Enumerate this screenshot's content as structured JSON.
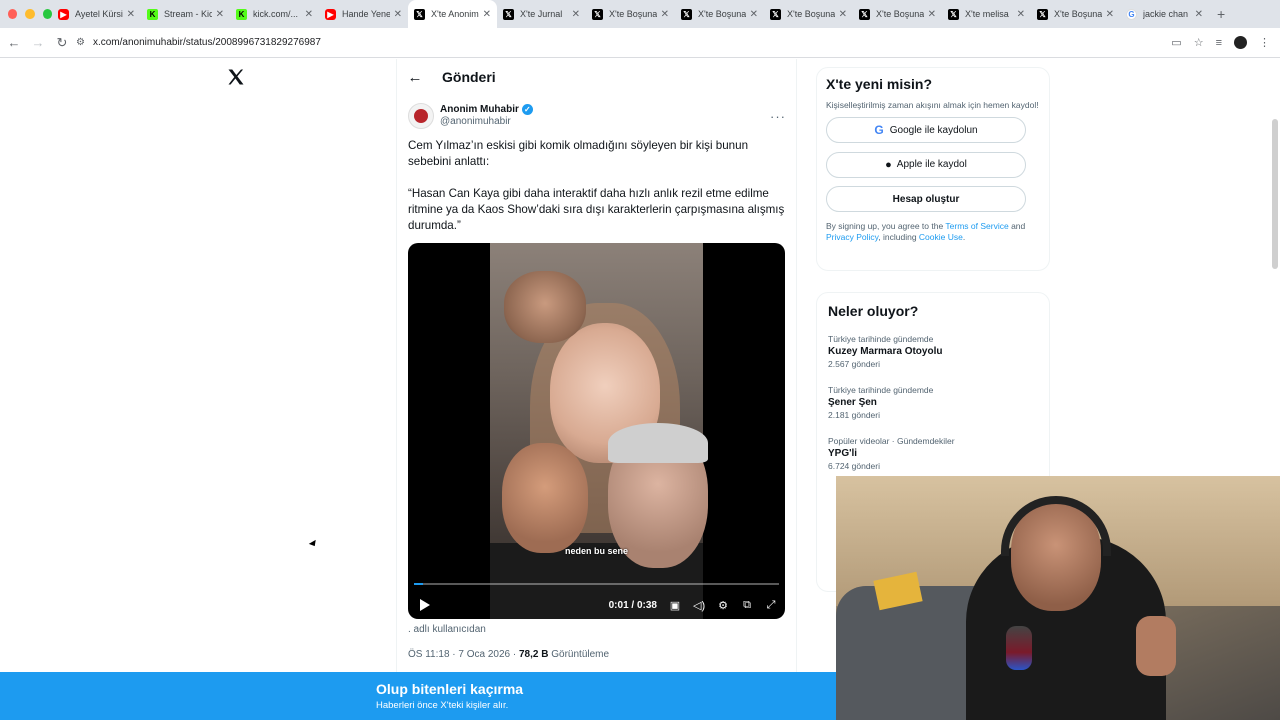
{
  "browser": {
    "tabs": [
      {
        "icon": "youtube",
        "title": "Ayetel Kürsi",
        "active": false
      },
      {
        "icon": "kick",
        "title": "Stream - Kick",
        "active": false
      },
      {
        "icon": "kick",
        "title": "kick.com/...",
        "active": false
      },
      {
        "icon": "youtube",
        "title": "Hande Yener",
        "active": false
      },
      {
        "icon": "x",
        "title": "X'te Anonim",
        "active": true
      },
      {
        "icon": "x",
        "title": "X'te Jurnal",
        "active": false
      },
      {
        "icon": "x",
        "title": "X'te Boşuna",
        "active": false
      },
      {
        "icon": "x",
        "title": "X'te Boşuna",
        "active": false
      },
      {
        "icon": "x",
        "title": "X'te Boşuna",
        "active": false
      },
      {
        "icon": "x",
        "title": "X'te Boşuna",
        "active": false
      },
      {
        "icon": "x",
        "title": "X'te melisa",
        "active": false
      },
      {
        "icon": "x",
        "title": "X'te Boşuna",
        "active": false
      },
      {
        "icon": "google",
        "title": "jackie chan",
        "active": false
      }
    ],
    "url": "x.com/anonimuhabir/status/2008996731829276987"
  },
  "post": {
    "header_title": "Gönderi",
    "author_name": "Anonim Muhabir",
    "author_handle": "@anonimuhabir",
    "text_1": "Cem Yılmaz’ın eskisi gibi komik olmadığını söyleyen bir kişi bunun sebebini anlattı:",
    "text_2": "“Hasan Can Kaya gibi daha interaktif daha hızlı anlık rezil etme edilme ritmine ya da Kaos Show’daki sıra dışı karakterlerin çarpışmasına alışmış durumda.”",
    "video": {
      "subtitle": "neden bu sene",
      "time": "0:01 / 0:38",
      "progress": 0.026
    },
    "attribution": ". adlı kullanıcıdan",
    "timestamp": "ÖS 11:18 · 7 Oca 2026 · ",
    "views_count": "78,2 B",
    "views_label": " Görüntüleme"
  },
  "signup": {
    "title": "X'te yeni misin?",
    "subtitle": "Kişiselleştirilmiş zaman akışını almak için hemen kaydol!",
    "google_label": "Google ile kaydolun",
    "apple_label": "Apple ile kaydol",
    "create_label": "Hesap oluştur",
    "legal_prefix": "By signing up, you agree to the ",
    "terms_label": "Terms of Service",
    "legal_and": " and ",
    "privacy_label": "Privacy Policy",
    "legal_including": ", including ",
    "cookie_label": "Cookie Use",
    "legal_end": "."
  },
  "trends": {
    "title": "Neler oluyor?",
    "items": [
      {
        "context": "Türkiye tarihinde gündemde",
        "name": "Kuzey Marmara Otoyolu",
        "count": "2.567 gönderi"
      },
      {
        "context": "Türkiye tarihinde gündemde",
        "name": "Şener Şen",
        "count": "2.181 gönderi"
      },
      {
        "context": "Popüler videolar · Gündemdekiler",
        "name": "YPG'li",
        "count": "6.724 gönderi"
      }
    ]
  },
  "banner": {
    "title": "Olup bitenleri kaçırma",
    "subtitle": "Haberleri önce X'teki kişiler alır."
  },
  "colors": {
    "accent": "#1d9bf0",
    "text": "#0f1419",
    "muted": "#536471"
  }
}
